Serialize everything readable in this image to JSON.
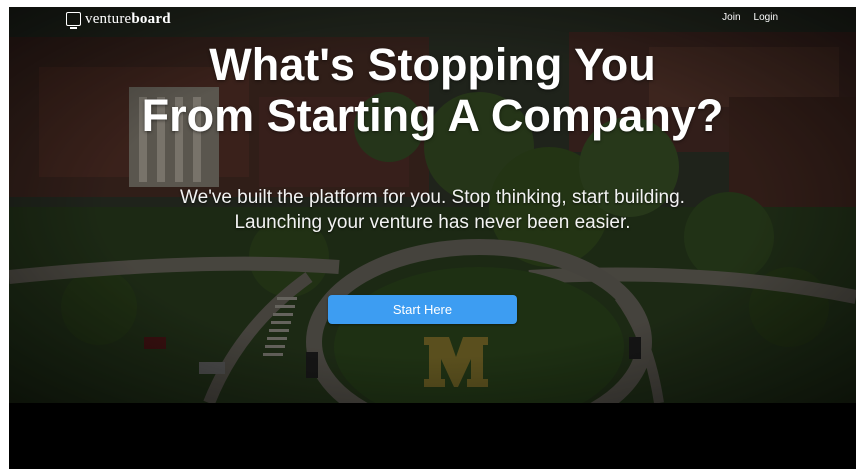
{
  "nav": {
    "logo_light": "venture",
    "logo_bold": "board",
    "links": [
      "Join",
      "Login"
    ]
  },
  "hero": {
    "headline_line1": "What's Stopping You",
    "headline_line2": "From Starting A Company?",
    "sub_line1": "We've built the platform for you. Stop thinking, start building.",
    "sub_line2": "Launching your venture has never been easier.",
    "cta_label": "Start Here",
    "background_icon": "campus-aerial-photo"
  },
  "colors": {
    "cta": "#3d9df2",
    "text": "#ffffff",
    "page_bottom": "#000000"
  }
}
